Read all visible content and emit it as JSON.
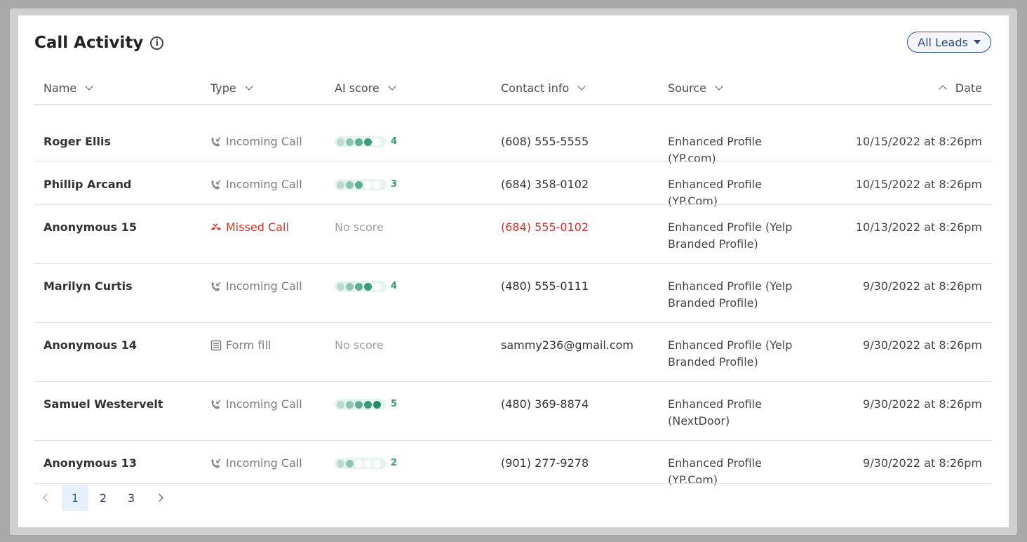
{
  "title": "Call Activity",
  "filter_button": {
    "label": "All Leads"
  },
  "columns": {
    "name": "Name",
    "type": "Type",
    "ai_score": "AI score",
    "contact": "Contact info",
    "source": "Source",
    "date": "Date"
  },
  "rows": [
    {
      "name": "Roger Ellis",
      "type": "Incoming Call",
      "type_icon": "incoming-call-icon",
      "score": "4",
      "score_value": 4,
      "contact": "(608) 555-5555",
      "source": "Enhanced Profile (YP.com)",
      "date": "10/15/2022 at 8:26pm"
    },
    {
      "name": "Phillip Arcand",
      "type": "Incoming Call",
      "type_icon": "incoming-call-icon",
      "score": "3",
      "score_value": 3,
      "contact": "(684) 358-0102",
      "source": "Enhanced Profile (YP.Com)",
      "date": "10/15/2022 at 8:26pm"
    },
    {
      "name": "Anonymous 15",
      "type": "Missed Call",
      "type_icon": "missed-call-icon",
      "score": "No score",
      "score_value": null,
      "contact": "(684) 555-0102",
      "source": "Enhanced Profile (Yelp Branded Profile)",
      "date": "10/13/2022 at 8:26pm"
    },
    {
      "name": "Marilyn Curtis",
      "type": "Incoming Call",
      "type_icon": "incoming-call-icon",
      "score": "4",
      "score_value": 4,
      "contact": "(480) 555-0111",
      "source": "Enhanced Profile (Yelp Branded Profile)",
      "date": "9/30/2022 at 8:26pm"
    },
    {
      "name": "Anonymous 14",
      "type": "Form fill",
      "type_icon": "form-icon",
      "score": "No score",
      "score_value": null,
      "contact": "sammy236@gmail.com",
      "source": "Enhanced Profile (Yelp Branded Profile)",
      "date": "9/30/2022 at 8:26pm"
    },
    {
      "name": "Samuel Westervelt",
      "type": "Incoming Call",
      "type_icon": "incoming-call-icon",
      "score": "5",
      "score_value": 5,
      "contact": "(480) 369-8874",
      "source": "Enhanced Profile (NextDoor)",
      "date": "9/30/2022 at 8:26pm"
    },
    {
      "name": "Anonymous 13",
      "type": "Incoming Call",
      "type_icon": "incoming-call-icon",
      "score": "2",
      "score_value": 2,
      "contact": "(901) 277-9278",
      "source": "Enhanced Profile (YP.Com)",
      "date": "9/30/2022 at 8:26pm"
    }
  ],
  "pagination": {
    "pages": [
      "1",
      "2",
      "3"
    ],
    "current": "1"
  },
  "colors": {
    "accent": "#2d4a8c",
    "missed": "#c0392b",
    "score": "#3a9a78"
  }
}
